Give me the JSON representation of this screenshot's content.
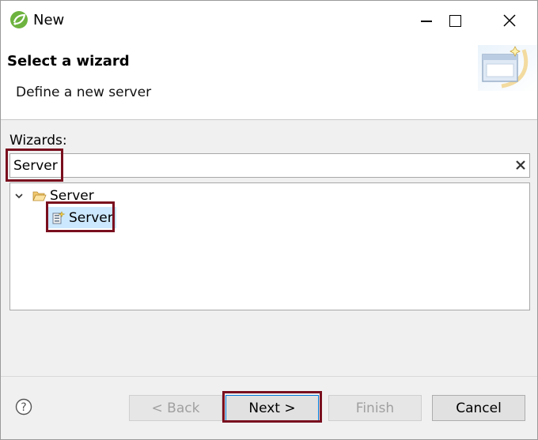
{
  "window": {
    "title": "New"
  },
  "banner": {
    "title": "Select a wizard",
    "description": "Define a new server"
  },
  "wizards": {
    "label": "Wizards:",
    "filter_value": "Server",
    "tree": [
      {
        "label": "Server",
        "expanded": true,
        "icon": "folder-open-icon",
        "children": [
          {
            "label": "Server",
            "icon": "server-wizard-icon",
            "selected": true
          }
        ]
      }
    ]
  },
  "buttons": {
    "back": "< Back",
    "next": "Next >",
    "finish": "Finish",
    "cancel": "Cancel"
  },
  "colors": {
    "highlight_border": "#7a0f1e",
    "selection": "#cce8ff",
    "default_button_border": "#0078d7"
  }
}
